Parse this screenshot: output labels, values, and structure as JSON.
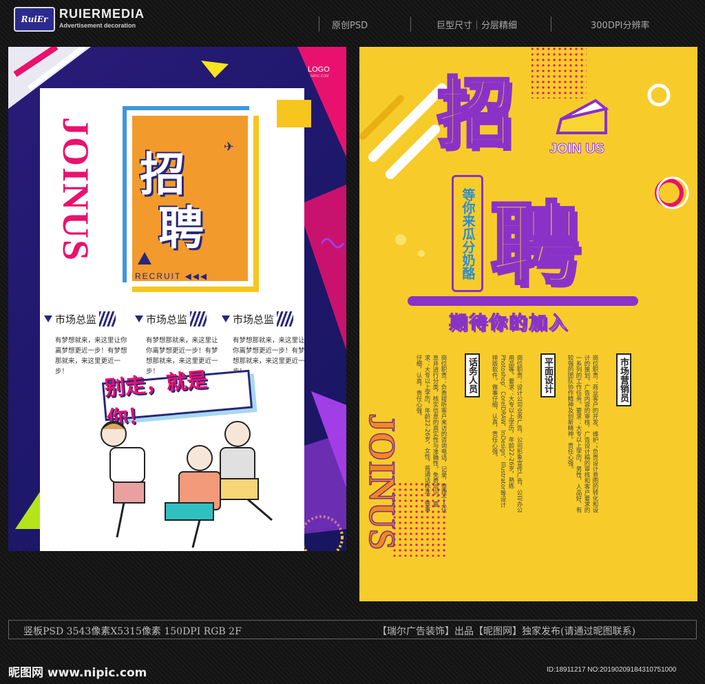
{
  "header": {
    "brand_logo": "RuiEr",
    "brand_name": "RUIERMEDIA",
    "brand_sub": "Advertisement decoration",
    "item_1": "原创PSD",
    "item_2": "巨型尺寸｜分层精细",
    "item_3": "300DPI分辨率"
  },
  "left_poster": {
    "logo": "LOGO",
    "logo_sub": "NIPIC.COM",
    "side_text": "JOINUS",
    "title_1": "招",
    "title_2": "聘",
    "recruit": "RECRUIT ◀◀◀",
    "jobs": [
      {
        "title": "市场总监",
        "desc": "有梦想就来，来这里让你离梦想更近一步！有梦想那就来，来这里更近一步！"
      },
      {
        "title": "市场总监",
        "desc": "有梦想那就来，来这里让你离梦想更近一步！有梦想那就来，来这里更近一步！"
      },
      {
        "title": "市场总监",
        "desc": "有梦想那就来，来这里让你离梦想更近一步！有梦想那就来，来这里更近一步！"
      }
    ],
    "slogan": "别走，就是你！"
  },
  "right_poster": {
    "title_1": "招",
    "title_2": "聘",
    "join_us": "JOIN US",
    "vertical_slogan": "等你来瓜分奶酪",
    "tagline": "期待你的加入",
    "positions": [
      {
        "title": "市场营销员",
        "body": "岗位职责：商业客户的开发、维护；负责设计意图的转化和设计的策划。广告内容的审核，广告设计稿的审核和客户要求的一系列的工作任务。要求：大专以上学历，男性，人品好，有较强的团队协作精神及创新精神。责任心强。"
      },
      {
        "title": "平面设计",
        "body": "岗位职责：设计公司业务广告，公司形象宣传广告，公司办公用品等。要求：大专以上学历，年龄22-26岁，熟练Photoshop、CorelDRAW、InDesign、Illustrator等设计排版软件。做事仔细，认真，责任心强。"
      },
      {
        "title": "话务人员",
        "body": "岗位职责：负责接听客户来访的咨询电话，记录，整理个人信息并进行分类，核实信息的真实性与准确性。免费培训。要求：大专以上学历，年龄22-26岁，女性，普通话标准，做事仔细，认真，责任心强。"
      }
    ],
    "side_text": "JOINUS"
  },
  "footer": {
    "left": "竖板PSD 3543像素X5315像素 150DPI RGB 2F",
    "right": "【瑞尔广告装饰】出品【昵图网】独家发布(请通过昵图联系)",
    "site": "昵图网 www.nipic.com",
    "image_id": "ID:18911217 NO:20190209184310751000"
  },
  "colors": {
    "left_bg": "#20186e",
    "pink": "#e8126e",
    "orange": "#f29a2c",
    "right_bg": "#f7cc2a",
    "purple": "#8a32c8",
    "blue_text": "#2c8bd0"
  }
}
